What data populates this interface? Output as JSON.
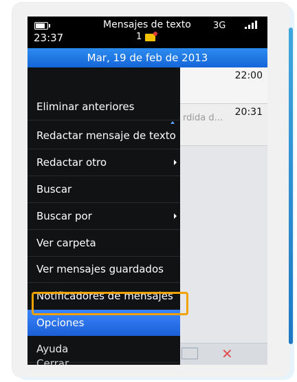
{
  "status": {
    "time": "23:37",
    "app_title": "Mensajes de texto",
    "unread_count": "1",
    "network": "3G"
  },
  "date_bar": {
    "label": "Mar, 19 de feb de 2013"
  },
  "list": {
    "row1_time": "22:00",
    "row2_time": "20:31",
    "row2_preview": "rdida d..."
  },
  "menu": {
    "items": [
      {
        "label": "Eliminar anteriores",
        "submenu": false,
        "selected": false
      },
      {
        "label": "Redactar mensaje de texto",
        "submenu": false,
        "selected": false
      },
      {
        "label": "Redactar otro",
        "submenu": true,
        "selected": false
      },
      {
        "label": "Buscar",
        "submenu": false,
        "selected": false
      },
      {
        "label": "Buscar por",
        "submenu": true,
        "selected": false
      },
      {
        "label": "Ver carpeta",
        "submenu": false,
        "selected": false
      },
      {
        "label": "Ver mensajes guardados",
        "submenu": false,
        "selected": false
      },
      {
        "label": "Notificadores de mensajes",
        "submenu": false,
        "selected": false
      },
      {
        "label": "Opciones",
        "submenu": false,
        "selected": true
      },
      {
        "label": "Ayuda",
        "submenu": false,
        "selected": false
      },
      {
        "label": "Cerrar",
        "submenu": false,
        "selected": false
      }
    ]
  },
  "icons": {
    "battery": "battery-icon",
    "unread": "envelope-icon",
    "signal": "signal-bars-icon",
    "compose": "mail-icon",
    "close": "close-icon"
  },
  "colors": {
    "accent": "#1c5fd6",
    "highlight": "#f2a200"
  }
}
